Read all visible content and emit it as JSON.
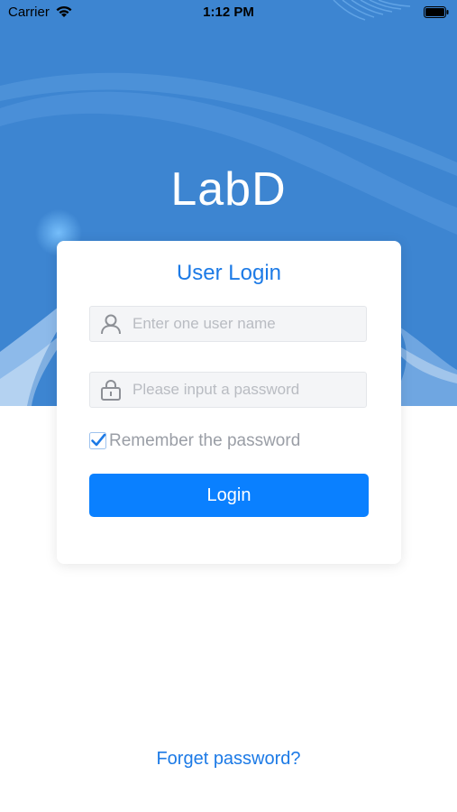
{
  "status_bar": {
    "carrier": "Carrier",
    "time": "1:12 PM"
  },
  "app": {
    "title": "LabD",
    "brand_color": "#3d85d1",
    "accent_color": "#0a80ff"
  },
  "login_card": {
    "title": "User Login",
    "username": {
      "placeholder": "Enter one user name",
      "value": "",
      "icon": "user-icon"
    },
    "password": {
      "placeholder": "Please input a password",
      "value": "",
      "icon": "lock-icon"
    },
    "remember": {
      "label": "Remember the password",
      "checked": true
    },
    "login_button": "Login"
  },
  "footer": {
    "forget_password": "Forget password?"
  }
}
